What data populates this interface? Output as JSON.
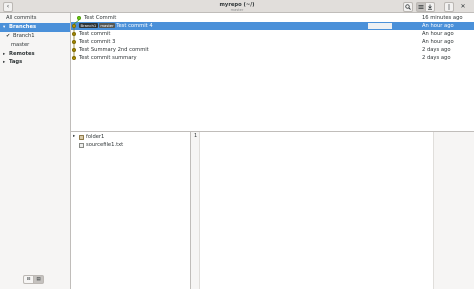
{
  "window": {
    "title": "myrepo (~/)",
    "subtitle": "master"
  },
  "sidebar": {
    "all_commits": "All commits",
    "branches_heading": "Branches",
    "branches": [
      {
        "label": "Branch1",
        "checked": true
      },
      {
        "label": "master",
        "checked": false
      }
    ],
    "remotes_heading": "Remotes",
    "tags_heading": "Tags"
  },
  "commits": [
    {
      "refs": [],
      "subject": "Test Commit",
      "date": "16 minutes ago",
      "color": "green",
      "selected": false
    },
    {
      "refs": [
        "Branch1",
        "master"
      ],
      "subject": "Test commit 4",
      "date": "An hour ago",
      "color": "yellow",
      "selected": true
    },
    {
      "refs": [],
      "subject": "Test commit",
      "date": "An hour ago",
      "color": "yellow",
      "selected": false
    },
    {
      "refs": [],
      "subject": "Test commit 3",
      "date": "An hour ago",
      "color": "yellow",
      "selected": false
    },
    {
      "refs": [],
      "subject": "Test Summary 2nd commit",
      "date": "2 days ago",
      "color": "yellow",
      "selected": false
    },
    {
      "refs": [],
      "subject": "Test commit summary",
      "date": "2 days ago",
      "color": "yellow",
      "selected": false
    }
  ],
  "files": [
    {
      "label": "folder1",
      "type": "folder"
    },
    {
      "label": "sourcefile1.txt",
      "type": "file"
    }
  ],
  "viewer": {
    "line_number": "1"
  },
  "colors": {
    "selection": "#4a90d9",
    "commit_dot": "#c4a000",
    "commit_dot_head": "#73d216"
  },
  "icons": {
    "back": "chevron-left-icon",
    "search": "search-icon",
    "view_mode": "list-icon",
    "download": "download-icon",
    "menu": "kebab-menu-icon",
    "close": "close-icon"
  }
}
